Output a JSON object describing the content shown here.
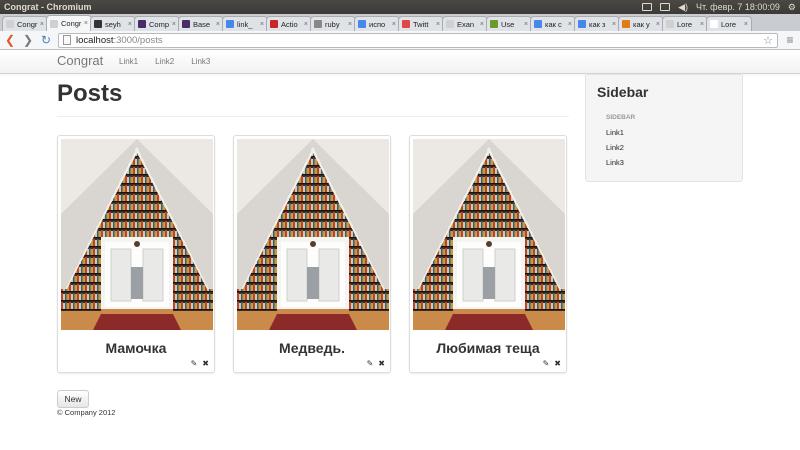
{
  "window": {
    "title": "Congrat - Chromium",
    "clock": "Чт. февр. 7 18:00:09"
  },
  "tabs": [
    {
      "label": "Congr",
      "color": "#d0d0d0",
      "active": false
    },
    {
      "label": "Congr",
      "color": "#d0d0d0",
      "active": true
    },
    {
      "label": "seyh",
      "color": "#333333",
      "active": false
    },
    {
      "label": "Comp",
      "color": "#4b2c68",
      "active": false
    },
    {
      "label": "Base",
      "color": "#4b2c68",
      "active": false
    },
    {
      "label": "link_",
      "color": "#4a86e8",
      "active": false
    },
    {
      "label": "Actio",
      "color": "#c62828",
      "active": false
    },
    {
      "label": "ruby",
      "color": "#888888",
      "active": false
    },
    {
      "label": "испо",
      "color": "#4a86e8",
      "active": false
    },
    {
      "label": "Twitt",
      "color": "#e04646",
      "active": false
    },
    {
      "label": "Exan",
      "color": "#d0d0d0",
      "active": false
    },
    {
      "label": "Use",
      "color": "#6a9a2a",
      "active": false
    },
    {
      "label": "как с",
      "color": "#4a86e8",
      "active": false
    },
    {
      "label": "как з",
      "color": "#4a86e8",
      "active": false
    },
    {
      "label": "как у",
      "color": "#e07b1a",
      "active": false
    },
    {
      "label": "Lore",
      "color": "#d0d0d0",
      "active": false
    },
    {
      "label": "Lore",
      "color": "#ffffff",
      "active": false
    }
  ],
  "omnibox": {
    "host": "localhost",
    "path": ":3000/posts"
  },
  "navbar": {
    "brand": "Congrat",
    "links": [
      "Link1",
      "Link2",
      "Link3"
    ]
  },
  "main": {
    "title": "Posts",
    "posts": [
      {
        "caption": "Мамочка"
      },
      {
        "caption": "Медведь."
      },
      {
        "caption": "Любимая теща"
      }
    ],
    "new_label": "New",
    "footer": "© Company 2012"
  },
  "sidebar": {
    "title": "Sidebar",
    "header": "SIDEBAR",
    "links": [
      "Link1",
      "Link2",
      "Link3"
    ]
  },
  "icons": {
    "edit": "pencil-icon",
    "delete": "remove-icon"
  }
}
